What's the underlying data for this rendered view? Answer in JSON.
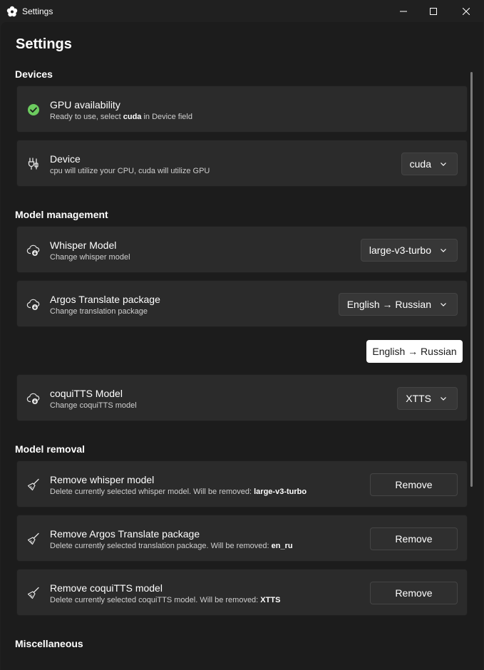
{
  "window": {
    "title": "Settings",
    "icon": "flower-icon",
    "controls": [
      "minimize-icon",
      "maximize-icon",
      "close-icon"
    ]
  },
  "page": {
    "title": "Settings"
  },
  "sections": {
    "devices": "Devices",
    "model_management": "Model management",
    "model_removal": "Model removal",
    "misc": "Miscellaneous"
  },
  "gpu": {
    "label": "GPU availability",
    "desc_prefix": "Ready to use, select ",
    "desc_bold": "cuda",
    "desc_suffix": " in Device field",
    "status_color": "#6ccb5f"
  },
  "device": {
    "label": "Device",
    "desc": "cpu will utilize your CPU, cuda will utilize GPU",
    "value": "cuda"
  },
  "whisper": {
    "label": "Whisper Model",
    "desc": "Change whisper model",
    "value": "large-v3-turbo"
  },
  "argos": {
    "label": "Argos Translate package",
    "desc": "Change translation package",
    "value": "English → Russian"
  },
  "tooltip": {
    "text": "English → Russian"
  },
  "coqui": {
    "label": "coquiTTS Model",
    "desc": "Change coquiTTS model",
    "value": "XTTS"
  },
  "remove_whisper": {
    "label": "Remove whisper model",
    "desc_prefix": "Delete currently selected whisper model. Will be removed: ",
    "desc_bold": "large-v3-turbo",
    "button": "Remove"
  },
  "remove_argos": {
    "label": "Remove Argos Translate package",
    "desc_prefix": "Delete currently selected translation package. Will be removed: ",
    "desc_bold": "en_ru",
    "button": "Remove"
  },
  "remove_coqui": {
    "label": "Remove coquiTTS model",
    "desc_prefix": "Delete currently selected coquiTTS model. Will be removed: ",
    "desc_bold": "XTTS",
    "button": "Remove"
  }
}
